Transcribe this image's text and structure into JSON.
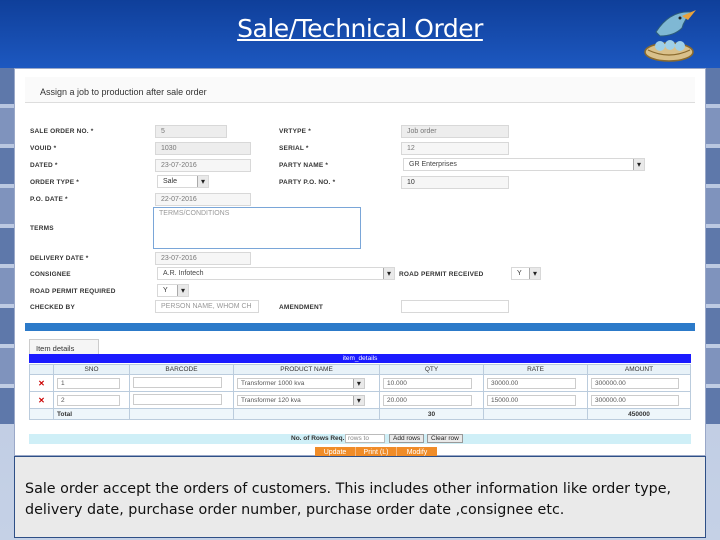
{
  "slide": {
    "title": "Sale/Technical Order",
    "caption": "Sale order accept the orders of customers. This includes other information like order type, delivery date, purchase order number, purchase order date ,consignee etc."
  },
  "colors": {
    "header": "#1d58c0",
    "band": "#2c7ac9",
    "grid_title": "#1a1aff",
    "action_bar": "#f08c28"
  },
  "form": {
    "heading": "Assign a job to production after sale order",
    "labels": {
      "sale_order_no": "SALE ORDER NO. *",
      "vrtype": "VRTYPE *",
      "vouid": "VOUID *",
      "serial": "SERIAL *",
      "dated": "DATED *",
      "party_name": "PARTY NAME *",
      "order_type": "ORDER TYPE *",
      "party_po_no": "PARTY P.O. NO. *",
      "po_date": "P.O. DATE *",
      "terms": "TERMS",
      "delivery_date": "DELIVERY DATE *",
      "consignee": "CONSIGNEE",
      "road_permit_received": "ROAD PERMIT RECEIVED",
      "road_permit_required": "ROAD PERMIT REQUIRED",
      "checked_by": "CHECKED BY",
      "amendment": "AMENDMENT"
    },
    "values": {
      "sale_order_no": "5",
      "vrtype": "Job order",
      "vouid": "1030",
      "serial": "12",
      "dated": "23-07-2016",
      "party_name": "GR Enterprises",
      "order_type": "Sale",
      "party_po_no": "10",
      "po_date": "22-07-2016",
      "terms_placeholder": "TERMS/CONDITIONS",
      "delivery_date": "23-07-2016",
      "consignee": "A.R. Infotech",
      "road_permit_received": "Y",
      "road_permit_required": "Y",
      "checked_by_placeholder": "PERSON NAME, WHOM CH",
      "amendment": ""
    }
  },
  "items": {
    "tab": "Item details",
    "grid_title": "item_details",
    "columns": [
      "SNO",
      "BARCODE",
      "PRODUCT NAME",
      "QTY",
      "RATE",
      "AMOUNT"
    ],
    "rows": [
      {
        "sno": "1",
        "barcode": "",
        "product": "Transformer 1000 kva",
        "qty": "10.000",
        "rate": "30000.00",
        "amount": "300000.00"
      },
      {
        "sno": "2",
        "barcode": "",
        "product": "Transformer 120 kva",
        "qty": "20.000",
        "rate": "15000.00",
        "amount": "300000.00"
      }
    ],
    "total_label": "Total",
    "total_qty": "30",
    "total_amount": "450000",
    "remove_glyph": "✕",
    "rows_label": "No. of Rows Req.",
    "rows_placeholder": "rows to",
    "add_rows": "Add rows",
    "clear_rows": "Clear row"
  },
  "actions": [
    "Update",
    "Print (L)",
    "Modify"
  ]
}
